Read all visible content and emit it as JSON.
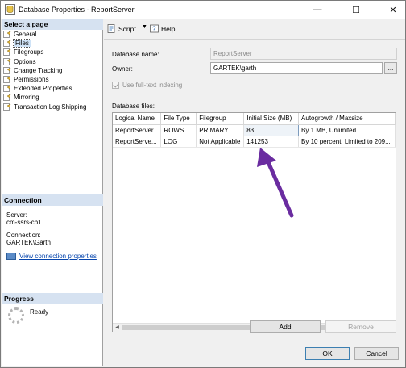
{
  "window": {
    "title": "Database Properties - ReportServer",
    "controls": {
      "minimize": "—",
      "maximize": "☐",
      "close": "✕"
    }
  },
  "left_pane": {
    "select_page_header": "Select a page",
    "pages": [
      {
        "label": "General",
        "icon": "page-icon",
        "selected": false
      },
      {
        "label": "Files",
        "icon": "page-icon",
        "selected": true
      },
      {
        "label": "Filegroups",
        "icon": "page-icon",
        "selected": false
      },
      {
        "label": "Options",
        "icon": "page-icon",
        "selected": false
      },
      {
        "label": "Change Tracking",
        "icon": "page-icon",
        "selected": false
      },
      {
        "label": "Permissions",
        "icon": "page-icon",
        "selected": false
      },
      {
        "label": "Extended Properties",
        "icon": "page-icon",
        "selected": false
      },
      {
        "label": "Mirroring",
        "icon": "page-icon",
        "selected": false
      },
      {
        "label": "Transaction Log Shipping",
        "icon": "page-icon",
        "selected": false
      }
    ],
    "connection_header": "Connection",
    "server_label": "Server:",
    "server_value": "cm-ssrs-cb1",
    "connection_label": "Connection:",
    "connection_value": "GARTEK\\Garth",
    "view_connection_link": "View connection properties",
    "progress_header": "Progress",
    "progress_status": "Ready"
  },
  "toolbar": {
    "script_label": "Script",
    "help_label": "Help"
  },
  "form": {
    "database_name_label": "Database name:",
    "database_name_value": "ReportServer",
    "owner_label": "Owner:",
    "owner_value": "GARTEK\\garth",
    "owner_browse": "...",
    "fulltext_label": "Use full-text indexing",
    "fulltext_checked": true,
    "database_files_label": "Database files:"
  },
  "files_table": {
    "columns": [
      "Logical Name",
      "File Type",
      "Filegroup",
      "Initial Size (MB)",
      "Autogrowth / Maxsize"
    ],
    "rows": [
      [
        "ReportServer",
        "ROWS...",
        "PRIMARY",
        "83",
        "By 1 MB, Unlimited"
      ],
      [
        "ReportServe...",
        "LOG",
        "Not Applicable",
        "141253",
        "By 10 percent, Limited to 209..."
      ]
    ]
  },
  "buttons": {
    "add": "Add",
    "remove": "Remove",
    "ok": "OK",
    "cancel": "Cancel"
  },
  "colors": {
    "accent_arrow": "#6a2ca0",
    "section_header_bg": "#d6e2f1",
    "link": "#0645ad"
  }
}
